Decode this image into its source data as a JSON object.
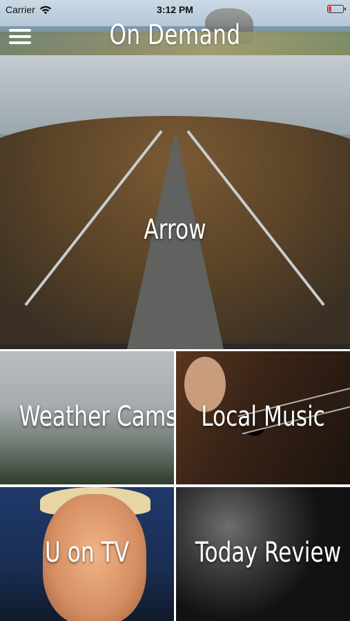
{
  "status_bar": {
    "carrier": "Carrier",
    "time": "3:12 PM",
    "battery_level": 0.18
  },
  "nav": {
    "title": "On Demand",
    "menu_icon": "hamburger-menu-icon"
  },
  "tiles": [
    {
      "label": "Arrow"
    },
    {
      "label": "Weather Cams"
    },
    {
      "label": "Local Music"
    },
    {
      "label": "U on TV"
    },
    {
      "label": "Today Review"
    }
  ]
}
